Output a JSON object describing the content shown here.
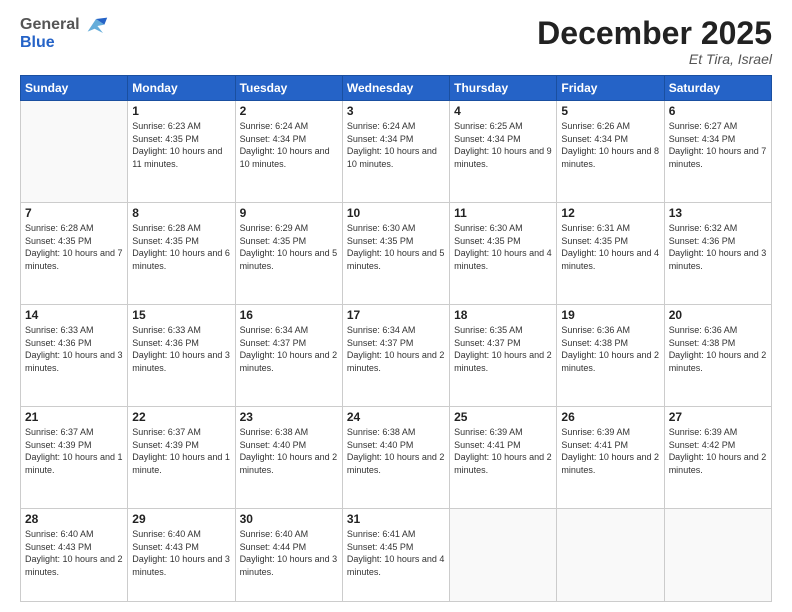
{
  "header": {
    "logo": {
      "general": "General",
      "blue": "Blue"
    },
    "title": "December 2025",
    "location": "Et Tira, Israel"
  },
  "calendar": {
    "days_of_week": [
      "Sunday",
      "Monday",
      "Tuesday",
      "Wednesday",
      "Thursday",
      "Friday",
      "Saturday"
    ],
    "weeks": [
      [
        {
          "day": "",
          "info": []
        },
        {
          "day": "1",
          "info": [
            "Sunrise: 6:23 AM",
            "Sunset: 4:35 PM",
            "Daylight: 10 hours and 11 minutes."
          ]
        },
        {
          "day": "2",
          "info": [
            "Sunrise: 6:24 AM",
            "Sunset: 4:34 PM",
            "Daylight: 10 hours and 10 minutes."
          ]
        },
        {
          "day": "3",
          "info": [
            "Sunrise: 6:24 AM",
            "Sunset: 4:34 PM",
            "Daylight: 10 hours and 10 minutes."
          ]
        },
        {
          "day": "4",
          "info": [
            "Sunrise: 6:25 AM",
            "Sunset: 4:34 PM",
            "Daylight: 10 hours and 9 minutes."
          ]
        },
        {
          "day": "5",
          "info": [
            "Sunrise: 6:26 AM",
            "Sunset: 4:34 PM",
            "Daylight: 10 hours and 8 minutes."
          ]
        },
        {
          "day": "6",
          "info": [
            "Sunrise: 6:27 AM",
            "Sunset: 4:34 PM",
            "Daylight: 10 hours and 7 minutes."
          ]
        }
      ],
      [
        {
          "day": "7",
          "info": [
            "Sunrise: 6:28 AM",
            "Sunset: 4:35 PM",
            "Daylight: 10 hours and 7 minutes."
          ]
        },
        {
          "day": "8",
          "info": [
            "Sunrise: 6:28 AM",
            "Sunset: 4:35 PM",
            "Daylight: 10 hours and 6 minutes."
          ]
        },
        {
          "day": "9",
          "info": [
            "Sunrise: 6:29 AM",
            "Sunset: 4:35 PM",
            "Daylight: 10 hours and 5 minutes."
          ]
        },
        {
          "day": "10",
          "info": [
            "Sunrise: 6:30 AM",
            "Sunset: 4:35 PM",
            "Daylight: 10 hours and 5 minutes."
          ]
        },
        {
          "day": "11",
          "info": [
            "Sunrise: 6:30 AM",
            "Sunset: 4:35 PM",
            "Daylight: 10 hours and 4 minutes."
          ]
        },
        {
          "day": "12",
          "info": [
            "Sunrise: 6:31 AM",
            "Sunset: 4:35 PM",
            "Daylight: 10 hours and 4 minutes."
          ]
        },
        {
          "day": "13",
          "info": [
            "Sunrise: 6:32 AM",
            "Sunset: 4:36 PM",
            "Daylight: 10 hours and 3 minutes."
          ]
        }
      ],
      [
        {
          "day": "14",
          "info": [
            "Sunrise: 6:33 AM",
            "Sunset: 4:36 PM",
            "Daylight: 10 hours and 3 minutes."
          ]
        },
        {
          "day": "15",
          "info": [
            "Sunrise: 6:33 AM",
            "Sunset: 4:36 PM",
            "Daylight: 10 hours and 3 minutes."
          ]
        },
        {
          "day": "16",
          "info": [
            "Sunrise: 6:34 AM",
            "Sunset: 4:37 PM",
            "Daylight: 10 hours and 2 minutes."
          ]
        },
        {
          "day": "17",
          "info": [
            "Sunrise: 6:34 AM",
            "Sunset: 4:37 PM",
            "Daylight: 10 hours and 2 minutes."
          ]
        },
        {
          "day": "18",
          "info": [
            "Sunrise: 6:35 AM",
            "Sunset: 4:37 PM",
            "Daylight: 10 hours and 2 minutes."
          ]
        },
        {
          "day": "19",
          "info": [
            "Sunrise: 6:36 AM",
            "Sunset: 4:38 PM",
            "Daylight: 10 hours and 2 minutes."
          ]
        },
        {
          "day": "20",
          "info": [
            "Sunrise: 6:36 AM",
            "Sunset: 4:38 PM",
            "Daylight: 10 hours and 2 minutes."
          ]
        }
      ],
      [
        {
          "day": "21",
          "info": [
            "Sunrise: 6:37 AM",
            "Sunset: 4:39 PM",
            "Daylight: 10 hours and 1 minute."
          ]
        },
        {
          "day": "22",
          "info": [
            "Sunrise: 6:37 AM",
            "Sunset: 4:39 PM",
            "Daylight: 10 hours and 1 minute."
          ]
        },
        {
          "day": "23",
          "info": [
            "Sunrise: 6:38 AM",
            "Sunset: 4:40 PM",
            "Daylight: 10 hours and 2 minutes."
          ]
        },
        {
          "day": "24",
          "info": [
            "Sunrise: 6:38 AM",
            "Sunset: 4:40 PM",
            "Daylight: 10 hours and 2 minutes."
          ]
        },
        {
          "day": "25",
          "info": [
            "Sunrise: 6:39 AM",
            "Sunset: 4:41 PM",
            "Daylight: 10 hours and 2 minutes."
          ]
        },
        {
          "day": "26",
          "info": [
            "Sunrise: 6:39 AM",
            "Sunset: 4:41 PM",
            "Daylight: 10 hours and 2 minutes."
          ]
        },
        {
          "day": "27",
          "info": [
            "Sunrise: 6:39 AM",
            "Sunset: 4:42 PM",
            "Daylight: 10 hours and 2 minutes."
          ]
        }
      ],
      [
        {
          "day": "28",
          "info": [
            "Sunrise: 6:40 AM",
            "Sunset: 4:43 PM",
            "Daylight: 10 hours and 2 minutes."
          ]
        },
        {
          "day": "29",
          "info": [
            "Sunrise: 6:40 AM",
            "Sunset: 4:43 PM",
            "Daylight: 10 hours and 3 minutes."
          ]
        },
        {
          "day": "30",
          "info": [
            "Sunrise: 6:40 AM",
            "Sunset: 4:44 PM",
            "Daylight: 10 hours and 3 minutes."
          ]
        },
        {
          "day": "31",
          "info": [
            "Sunrise: 6:41 AM",
            "Sunset: 4:45 PM",
            "Daylight: 10 hours and 4 minutes."
          ]
        },
        {
          "day": "",
          "info": []
        },
        {
          "day": "",
          "info": []
        },
        {
          "day": "",
          "info": []
        }
      ]
    ]
  }
}
